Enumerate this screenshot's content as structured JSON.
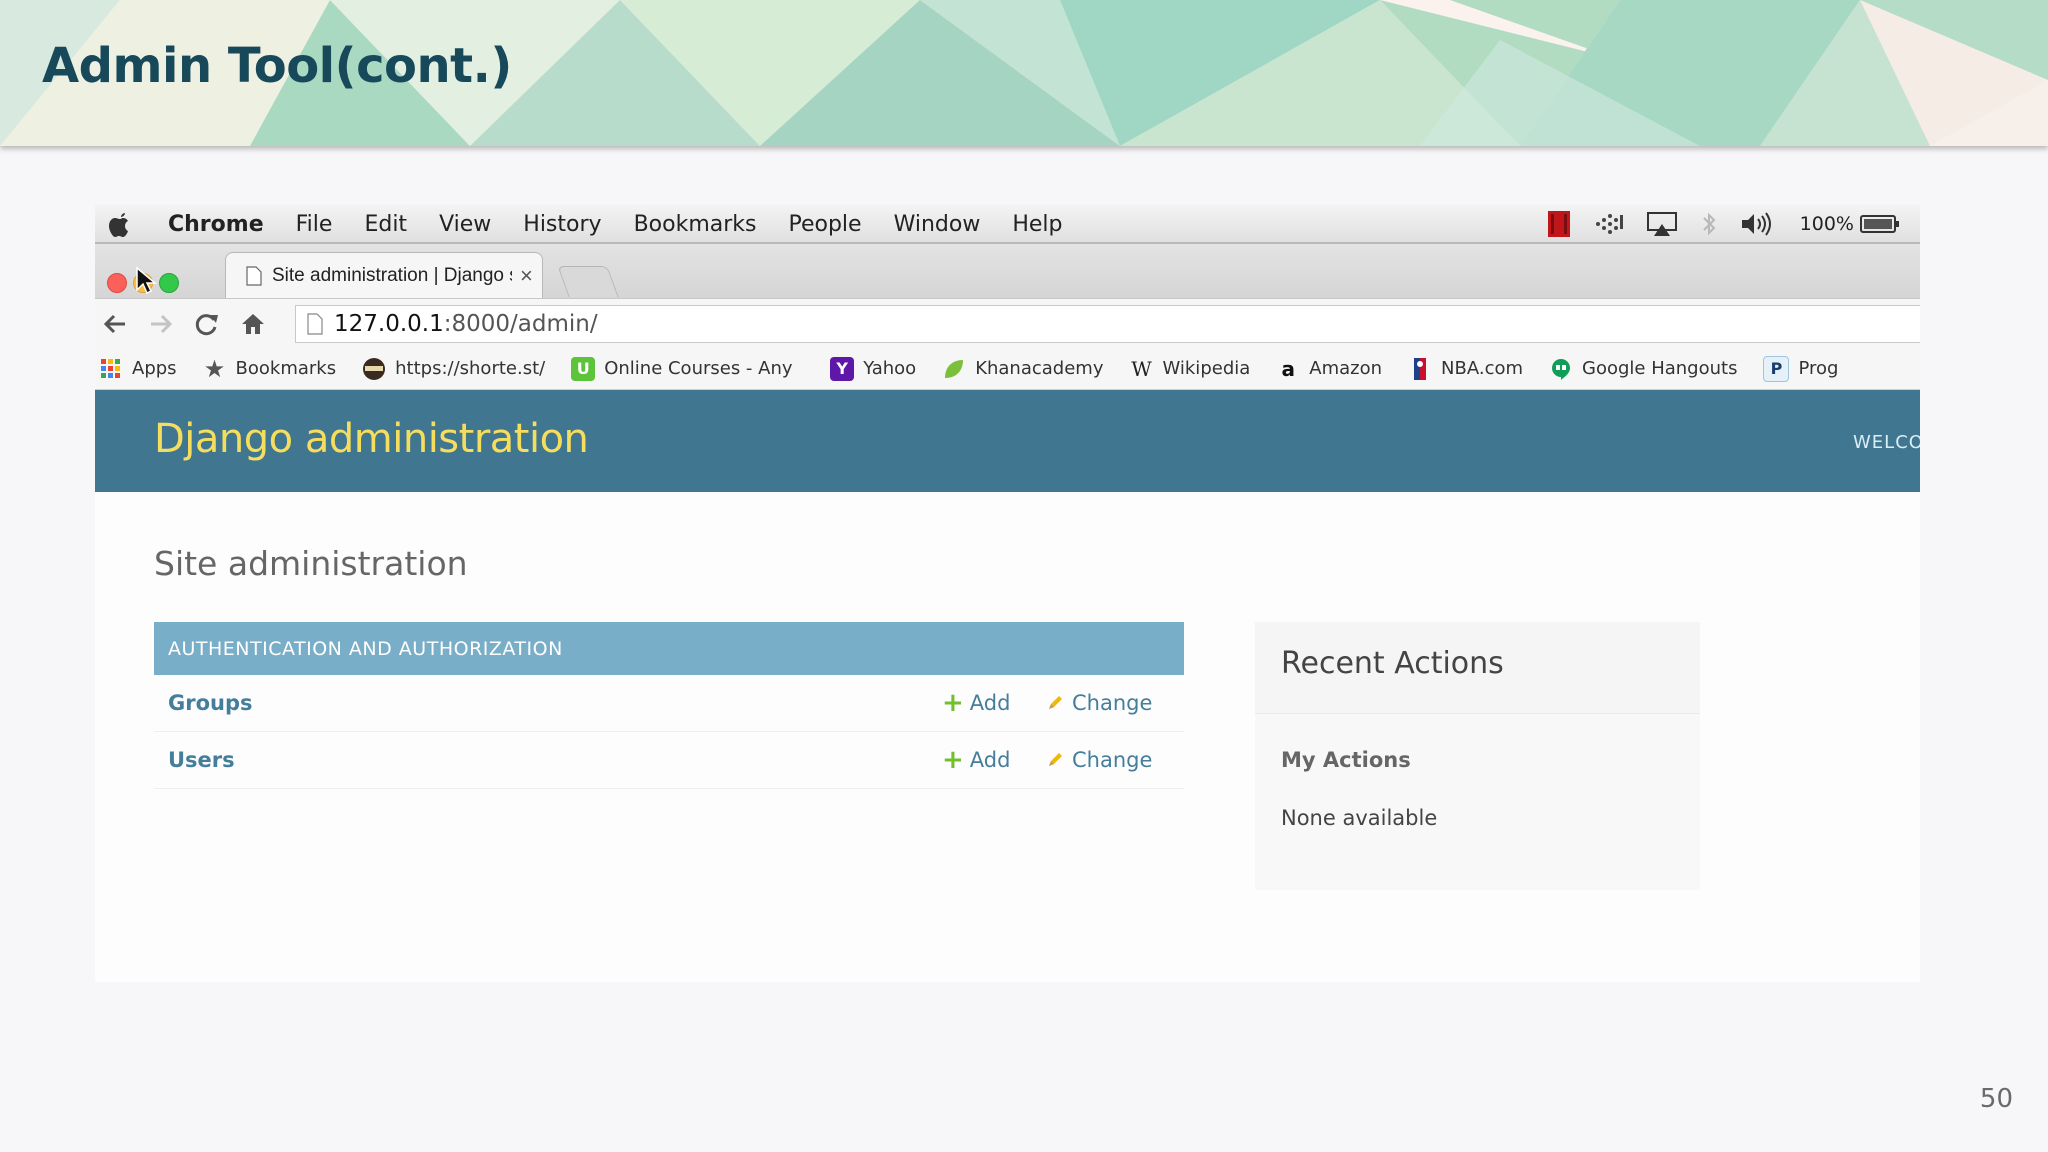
{
  "slide": {
    "title": "Admin Tool(cont.)",
    "page_number": "50"
  },
  "mac_menubar": {
    "app_name": "Chrome",
    "menus": [
      "File",
      "Edit",
      "View",
      "History",
      "Bookmarks",
      "People",
      "Window",
      "Help"
    ],
    "battery_percent": "100%"
  },
  "browser": {
    "tab_title": "Site administration | Django site admin",
    "tab_close": "×",
    "url_host": "127.0.0.1",
    "url_rest": ":8000/admin/",
    "bookmarks": [
      {
        "label": "Apps",
        "icon": "apps-grid-icon"
      },
      {
        "label": "Bookmarks",
        "icon": "star-icon"
      },
      {
        "label": "https://shorte.st/",
        "icon": "shortest-icon"
      },
      {
        "label": "Online Courses - Any",
        "icon": "udemy-icon"
      },
      {
        "label": "Yahoo",
        "icon": "yahoo-icon"
      },
      {
        "label": "Khanacademy",
        "icon": "khan-leaf-icon"
      },
      {
        "label": "Wikipedia",
        "icon": "wikipedia-icon"
      },
      {
        "label": "Amazon",
        "icon": "amazon-icon"
      },
      {
        "label": "NBA.com",
        "icon": "nba-icon"
      },
      {
        "label": "Google Hangouts",
        "icon": "hangouts-icon"
      },
      {
        "label": "Prog",
        "icon": "p-icon"
      }
    ]
  },
  "django": {
    "site_name": "Django administration",
    "welcome": "WELCO",
    "content_title": "Site administration",
    "module_caption": "AUTHENTICATION AND AUTHORIZATION",
    "models": [
      {
        "name": "Groups",
        "add": "Add",
        "change": "Change"
      },
      {
        "name": "Users",
        "add": "Add",
        "change": "Change"
      }
    ],
    "recent_actions": {
      "title": "Recent Actions",
      "subtitle": "My Actions",
      "empty": "None available"
    }
  },
  "colors": {
    "title": "#17495a",
    "django_header": "#417690",
    "site_name": "#f5dd5d",
    "module_caption": "#79aec8",
    "link": "#447e9b"
  }
}
